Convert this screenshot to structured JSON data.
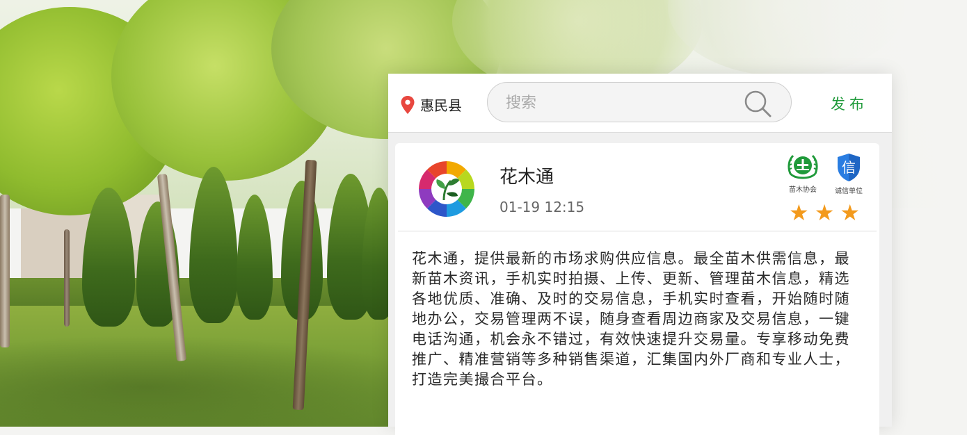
{
  "header": {
    "location": "惠民县",
    "search_placeholder": "搜索",
    "publish_label": "发布"
  },
  "listing": {
    "name": "花木通",
    "time": "01-19 12:15",
    "badges": [
      {
        "label": "苗木协会",
        "icon": "association-emblem-icon",
        "color": "#1f9a3a"
      },
      {
        "label": "诚信单位",
        "icon": "credit-shield-icon",
        "glyph": "信",
        "color": "#2a7de1"
      }
    ],
    "rating": 3,
    "description": "花木通，提供最新的市场求购供应信息。最全苗木供需信息，最新苗木资讯，手机实时拍摄、上传、更新、管理苗木信息，精选各地优质、准确、及时的交易信息，手机实时查看，开始随时随地办公，交易管理两不误，随身查看周边商家及交易信息，一键电话沟通，机会永不错过，有效快速提升交易量。专享移动免费推广、精准营销等多种销售渠道，汇集国内外厂商和专业人士，打造完美撮合平台。"
  },
  "colors": {
    "accent_green": "#1f9a3a",
    "star": "#f39a1c",
    "location_pin": "#e8473f"
  }
}
